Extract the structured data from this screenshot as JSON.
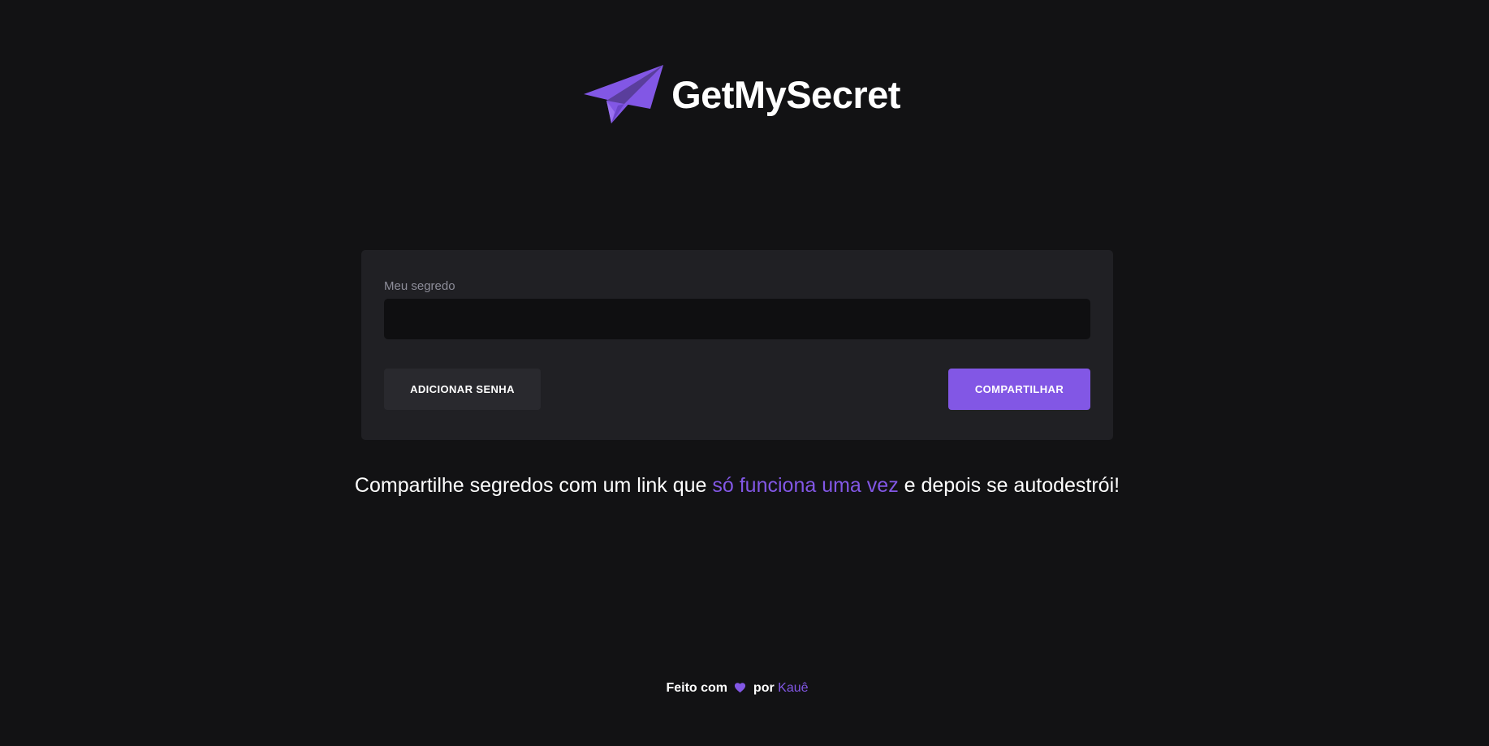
{
  "brand": {
    "name": "GetMySecret",
    "icon": "paper-plane-icon",
    "accent_color": "#8257e5"
  },
  "form": {
    "secret_label": "Meu segredo",
    "secret_value": "",
    "add_password_label": "ADICIONAR SENHA",
    "share_label": "COMPARTILHAR"
  },
  "tagline": {
    "before": "Compartilhe segredos com um link que ",
    "highlight": "só funciona uma vez",
    "after": " e depois se autodestrói!"
  },
  "footer": {
    "made_with": "Feito com",
    "heart_icon": "heart-icon",
    "by": "por",
    "author": "Kauê"
  }
}
